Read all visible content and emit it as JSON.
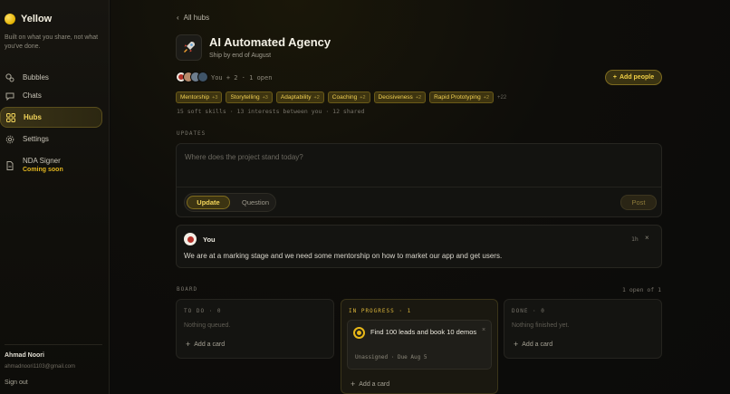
{
  "app": {
    "name": "Yellow",
    "tagline": "Built on what you share, not what you've done."
  },
  "sidebar": {
    "items": [
      {
        "label": "Bubbles",
        "icon": "bubbles-icon"
      },
      {
        "label": "Chats",
        "icon": "chat-icon"
      },
      {
        "label": "Hubs",
        "icon": "grid-icon",
        "active": true
      },
      {
        "label": "Settings",
        "icon": "gear-icon"
      },
      {
        "label": "NDA Signer",
        "icon": "document-icon",
        "badge": "Coming soon"
      }
    ],
    "user": {
      "name": "Ahmad Noori",
      "email": "ahmadnoori1103@gmail.com",
      "sign_out": "Sign out"
    }
  },
  "hub": {
    "back_label": "All hubs",
    "icon": "rocket-icon",
    "title": "AI Automated Agency",
    "subtitle": "Ship by end of August",
    "members_text": "You + 2 · 1 open",
    "add_people_label": "Add people",
    "tags": [
      {
        "label": "Mentorship",
        "count": "+3"
      },
      {
        "label": "Storytelling",
        "count": "+3"
      },
      {
        "label": "Adaptability",
        "count": "+2"
      },
      {
        "label": "Coaching",
        "count": "+2"
      },
      {
        "label": "Decisiveness",
        "count": "+2"
      },
      {
        "label": "Rapid Prototyping",
        "count": "+2"
      }
    ],
    "tags_more": "+22",
    "stats": "15 soft skills · 13 interests between you · 12 shared"
  },
  "updates": {
    "section_label": "UPDATES",
    "placeholder": "Where does the project stand today?",
    "mode_update": "Update",
    "mode_question": "Question",
    "post_label": "Post",
    "posts": [
      {
        "author": "You",
        "time": "1h",
        "body": "We are at a marking stage and we need some mentorship on how to market our app and get users."
      }
    ]
  },
  "board": {
    "section_label": "BOARD",
    "count_label": "1 open of 1",
    "add_card_label": "Add a card",
    "columns": [
      {
        "title": "TO DO · 0",
        "empty": "Nothing queued."
      },
      {
        "title": "IN PROGRESS · 1",
        "card": {
          "title": "Find 100 leads and book 10 demos",
          "meta": "Unassigned · Due Aug 5"
        }
      },
      {
        "title": "DONE · 0",
        "empty": "Nothing finished yet."
      }
    ]
  },
  "colors": {
    "accent": "#f2d052",
    "accent_bg": "#3d3410",
    "background": "#0b0b0a"
  }
}
